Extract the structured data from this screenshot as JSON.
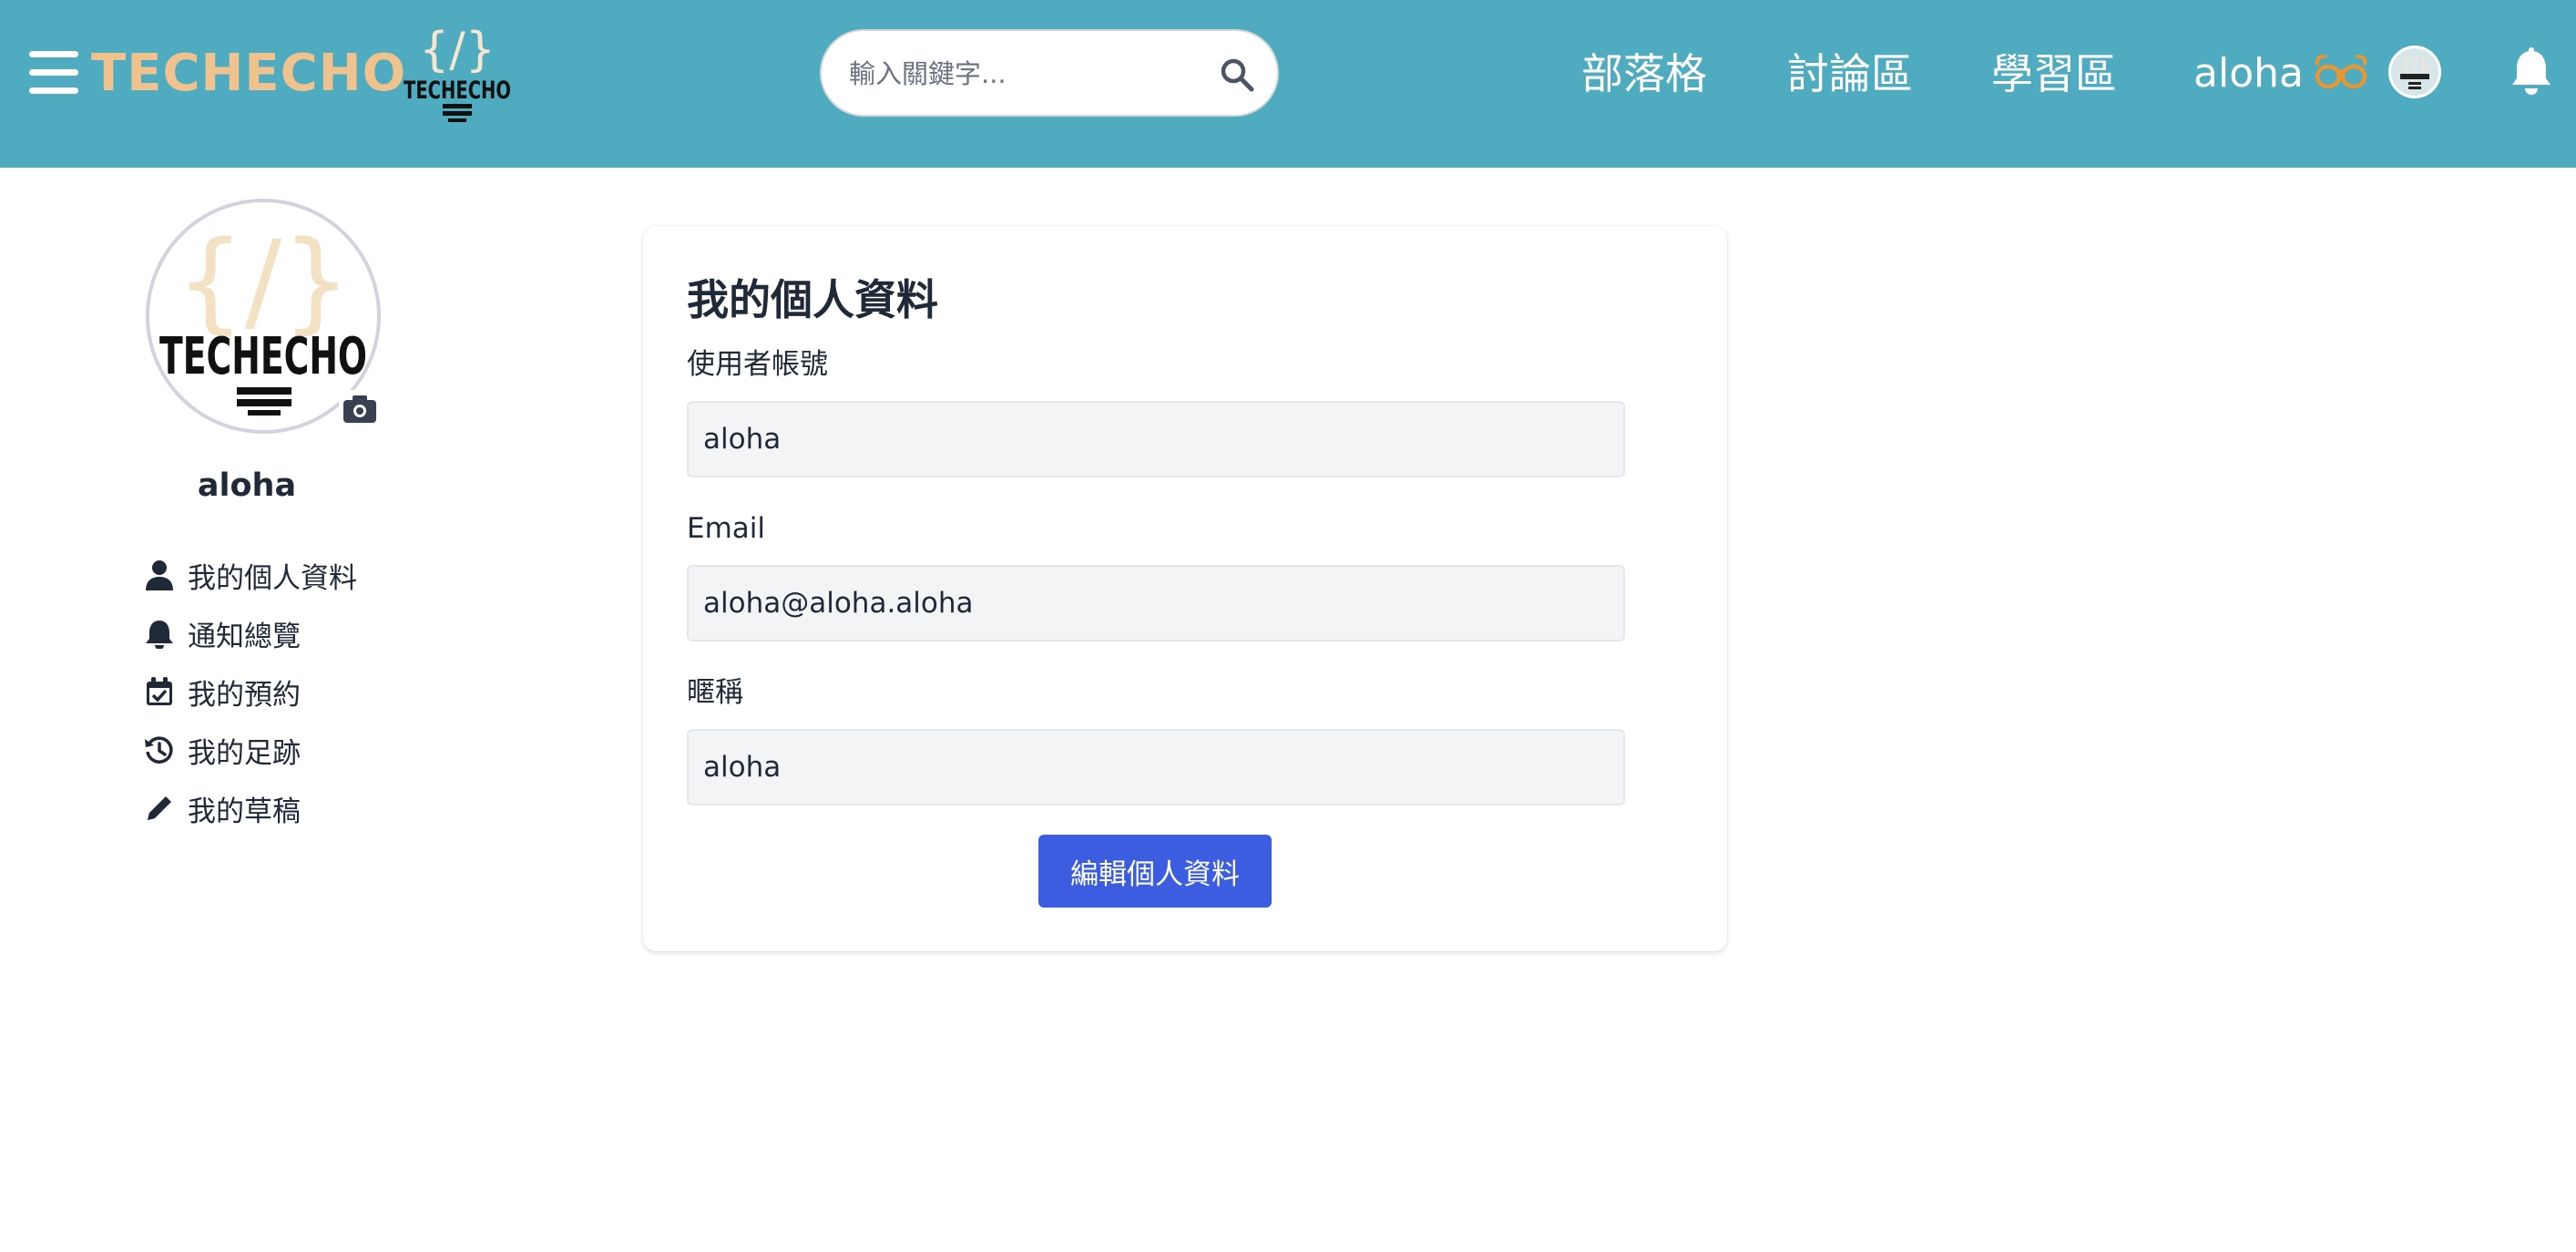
{
  "header": {
    "brand": "TECHECHO",
    "logo_text": "TECHECHO",
    "search_placeholder": "輸入關鍵字...",
    "nav": [
      "部落格",
      "討論區",
      "學習區"
    ],
    "user_name": "aloha",
    "icons": [
      "menu-icon",
      "search-icon",
      "glasses-icon",
      "bell-icon"
    ],
    "colors": {
      "bar": "#4fabbf",
      "brand": "#f0c38e",
      "glasses": "#e8962e"
    }
  },
  "sidebar": {
    "avatar_text": "TECHECHO",
    "name": "aloha",
    "items": [
      {
        "label": "我的個人資料",
        "icon": "user-icon"
      },
      {
        "label": "通知總覽",
        "icon": "bell-icon"
      },
      {
        "label": "我的預約",
        "icon": "calendar-check-icon"
      },
      {
        "label": "我的足跡",
        "icon": "history-icon"
      },
      {
        "label": "我的草稿",
        "icon": "pencil-icon"
      }
    ]
  },
  "profile": {
    "title": "我的個人資料",
    "fields": [
      {
        "label": "使用者帳號",
        "value": "aloha"
      },
      {
        "label": "Email",
        "value": "aloha@aloha.aloha"
      },
      {
        "label": "暱稱",
        "value": "aloha"
      }
    ],
    "edit_button": "編輯個人資料",
    "colors": {
      "button": "#3c5de0"
    }
  }
}
